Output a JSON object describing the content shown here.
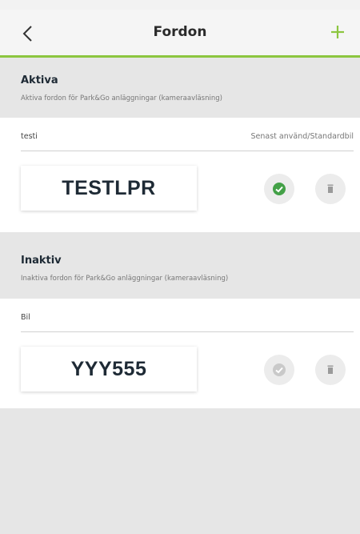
{
  "header": {
    "title": "Fordon",
    "accent_color": "#8cc63f"
  },
  "sections": [
    {
      "title": "Aktiva",
      "subtitle": "Aktiva fordon för Park&Go anläggningar (kameraavläsning)",
      "vehicle": {
        "name": "testi",
        "status": "Senast använd/Standardbil",
        "plate": "TESTLPR",
        "default_icon": "check-circle-icon",
        "default_active": true
      }
    },
    {
      "title": "Inaktiv",
      "subtitle": "Inaktiva fordon för Park&Go anläggningar (kameraavläsning)",
      "vehicle": {
        "name": "Bil",
        "status": "",
        "plate": "YYY555",
        "default_icon": "check-circle-icon",
        "default_active": false
      }
    }
  ]
}
